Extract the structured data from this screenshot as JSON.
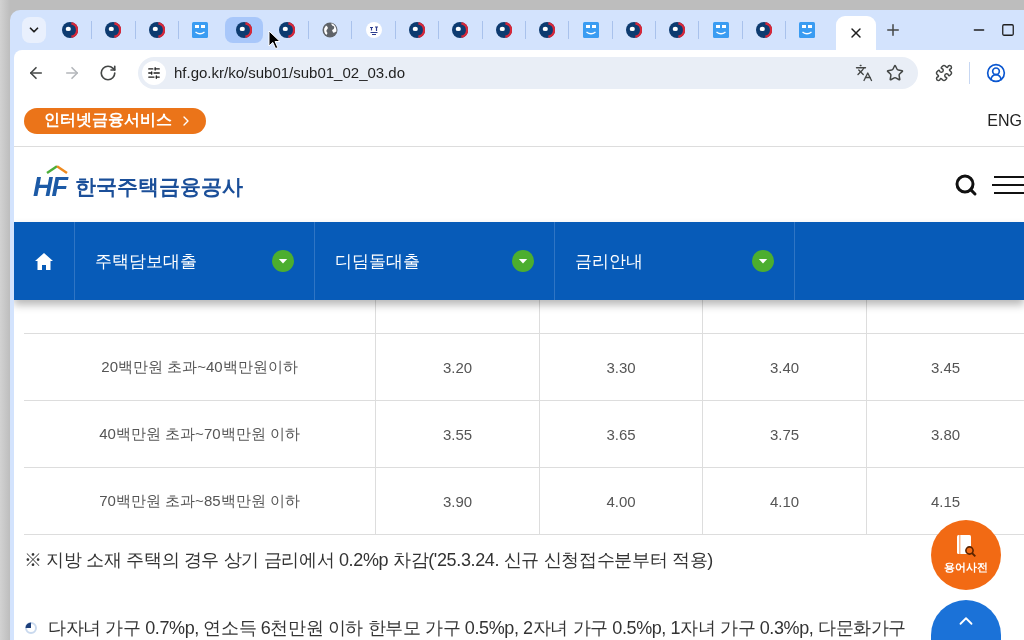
{
  "browser": {
    "tabs": [
      {
        "kind": "emblem",
        "selected": false,
        "hovered": false
      },
      {
        "kind": "emblem",
        "selected": false,
        "hovered": false
      },
      {
        "kind": "emblem",
        "selected": false,
        "hovered": false
      },
      {
        "kind": "app",
        "selected": false,
        "hovered": false
      },
      {
        "kind": "emblem",
        "selected": false,
        "hovered": true
      },
      {
        "kind": "emblem",
        "selected": false,
        "hovered": false
      },
      {
        "kind": "globe",
        "selected": false,
        "hovered": false
      },
      {
        "kind": "seal",
        "selected": false,
        "hovered": false
      },
      {
        "kind": "emblem",
        "selected": false,
        "hovered": false
      },
      {
        "kind": "emblem",
        "selected": false,
        "hovered": false
      },
      {
        "kind": "emblem",
        "selected": false,
        "hovered": false
      },
      {
        "kind": "emblem",
        "selected": false,
        "hovered": false
      },
      {
        "kind": "app",
        "selected": false,
        "hovered": false
      },
      {
        "kind": "emblem",
        "selected": false,
        "hovered": false
      },
      {
        "kind": "emblem",
        "selected": false,
        "hovered": false
      },
      {
        "kind": "app",
        "selected": false,
        "hovered": false
      },
      {
        "kind": "emblem",
        "selected": false,
        "hovered": false
      },
      {
        "kind": "app",
        "selected": false,
        "hovered": false
      },
      {
        "selected": true,
        "hovered": false
      }
    ],
    "nav_buttons": [
      {
        "kind": "back",
        "disabled": false
      },
      {
        "kind": "forward",
        "disabled": true
      },
      {
        "kind": "reload",
        "disabled": false
      }
    ],
    "address": "hf.go.kr/ko/sub01/sub01_02_03.do"
  },
  "utility_bar": {
    "service_button": "인터넷금융서비스",
    "language_link": "ENG"
  },
  "header": {
    "logo_initials": "HF",
    "logo_name": "한국주택금융공사"
  },
  "nav": {
    "items": [
      {
        "label": "주택담보대출"
      },
      {
        "label": "디딤돌대출"
      },
      {
        "label": "금리안내"
      }
    ]
  },
  "table": {
    "rows": [
      {
        "cells": [
          "20백만원 초과~40백만원이하",
          "3.20",
          "3.30",
          "3.40",
          "3.45"
        ]
      },
      {
        "cells": [
          "40백만원 초과~70백만원 이하",
          "3.55",
          "3.65",
          "3.75",
          "3.80"
        ]
      },
      {
        "cells": [
          "70백만원 초과~85백만원 이하",
          "3.90",
          "4.00",
          "4.10",
          "4.15"
        ]
      }
    ]
  },
  "notes": [
    {
      "kind": "reference",
      "text": "※ 지방 소재 주택의 경우 상기 금리에서 0.2%p 차감('25.3.24. 신규 신청접수분부터 적용)"
    },
    {
      "kind": "bullet",
      "text": "다자녀 가구 0.7%p, 연소득 6천만원 이하 한부모 가구 0.5%p, 2자녀 가구 0.5%p, 1자녀 가구 0.3%p, 다문화가구"
    }
  ],
  "floating_buttons": [
    {
      "kind": "glossary",
      "label": "용어사전"
    },
    {
      "kind": "top"
    }
  ]
}
